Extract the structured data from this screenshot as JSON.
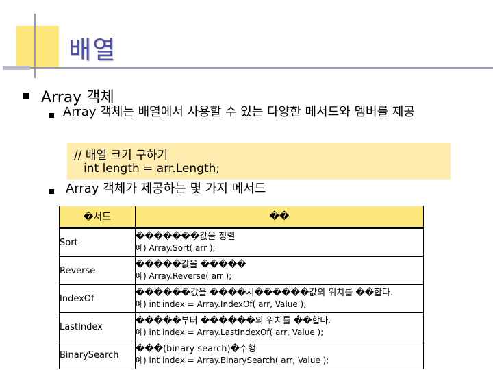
{
  "slide": {
    "title": "배열",
    "bullet1": "Array 객체",
    "sub1": "Array 객체는 배열에서 사용할 수 있는 다양한 메서드와 멤버를 제공",
    "code": {
      "line1": "// 배열 크기 구하기",
      "line2": "int length = arr.Length;"
    },
    "sub2": "Array 객체가 제공하는 몇 가지 메서드"
  },
  "table": {
    "headers": {
      "name": "�서드",
      "desc": "��"
    },
    "rows": [
      {
        "name": "Sort",
        "desc": "�������값을 정렬",
        "example": "예) Array.Sort( arr );"
      },
      {
        "name": "Reverse",
        "desc": "�����값을 �����",
        "example": "예) Array.Reverse( arr );"
      },
      {
        "name": "IndexOf",
        "desc": "������값을 ����서������값의 위치를 ��합다.",
        "example": "예) int index = Array.IndexOf( arr, Value );"
      },
      {
        "name": "LastIndex",
        "desc": "�����부터 ������의 위치를 ��합다.",
        "example": "예) int index = Array.LastIndexOf( arr, Value );"
      },
      {
        "name": "BinarySearch",
        "desc": "���(binary search)�수행",
        "example": "예) int index = Array.BinarySearch( arr, Value );"
      }
    ]
  }
}
